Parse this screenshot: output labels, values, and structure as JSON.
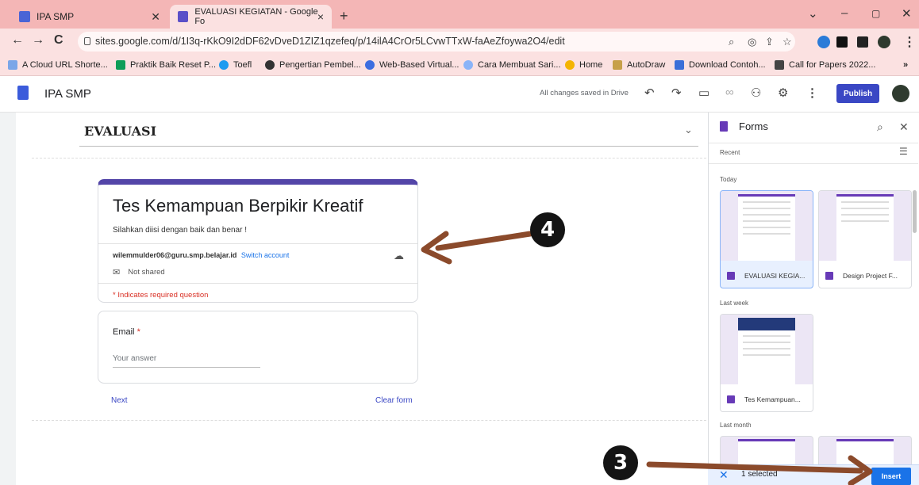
{
  "browser": {
    "tabs": [
      {
        "title": "IPA SMP",
        "close": ""
      },
      {
        "title": "EVALUASI KEGIATAN - Google Fo",
        "close": "×"
      }
    ],
    "new_tab": "+",
    "window_controls": [
      "⌄",
      "–",
      "▢",
      "✕"
    ],
    "url": "sites.google.com/d/1I3q-rKkO9I2dDF62vDveD1ZIZ1qzefeq/p/14ilA4CrOr5LCvwTTxW-faAeZfoywa2O4/edit",
    "bookmarks": [
      "A Cloud URL Shorte...",
      "Praktik Baik Reset P...",
      "Toefl",
      "Pengertian Pembel...",
      "Web-Based Virtual...",
      "Cara Membuat Sari...",
      "Home",
      "AutoDraw",
      "Download Contoh...",
      "Call for Papers 2022..."
    ],
    "bookmarks_more": "»"
  },
  "sites": {
    "app_name": "IPA SMP",
    "saved_status": "All changes saved in Drive",
    "publish_label": "Publish"
  },
  "page": {
    "section_title": "EVALUASI"
  },
  "form": {
    "title": "Tes Kemampuan Berpikir Kreatif",
    "description": "Silahkan diisi dengan baik dan benar !",
    "account_email": "wilemmulder06@guru.smp.belajar.id",
    "switch_account": "Switch account",
    "not_shared": "Not shared",
    "required_note": "* Indicates required question",
    "question_label": "Email",
    "required_star": "*",
    "answer_placeholder": "Your answer",
    "next_label": "Next",
    "clear_label": "Clear form"
  },
  "forms_panel": {
    "title": "Forms",
    "recent_label": "Recent",
    "groups": {
      "today": "Today",
      "last_week": "Last week",
      "last_month": "Last month"
    },
    "tiles": [
      {
        "label": "EVALUASI KEGIA..."
      },
      {
        "label": "Design Project F..."
      },
      {
        "label": "Tes Kemampuan..."
      }
    ],
    "selection_count": "1 selected",
    "insert_label": "Insert"
  },
  "annotations": {
    "step_insert": "3",
    "step_form": "4"
  },
  "colors": {
    "tab_strip": "#f4b6b6",
    "publish_button": "#3a47c4",
    "form_accent": "#5345a8",
    "insert_button": "#1a73e8",
    "annotation_arrow": "#8b4a2b"
  }
}
